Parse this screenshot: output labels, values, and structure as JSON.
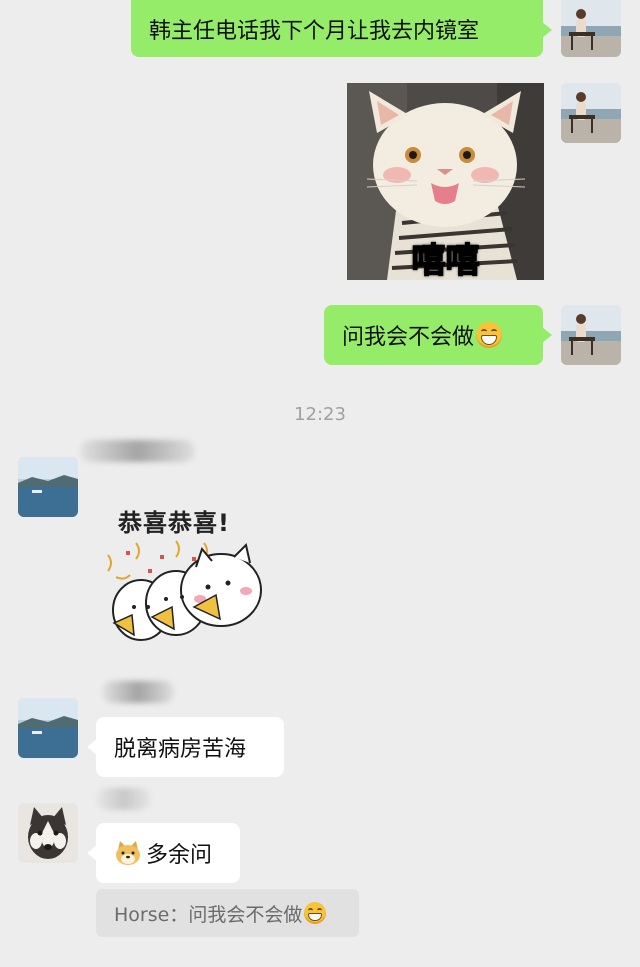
{
  "messages": {
    "m1": {
      "text": "韩主任电话我下个月让我去内镜室"
    },
    "m2": {
      "sticker_caption": "嘻嘻"
    },
    "m3": {
      "text": "问我会不会做"
    },
    "m4": {
      "sticker_caption": "恭喜恭喜!"
    },
    "m5": {
      "text": "脱离病房苦海"
    },
    "m6": {
      "text": "多余问"
    }
  },
  "timestamp": "12:23",
  "quote": {
    "sender": "Horse：",
    "text": "问我会不会做"
  },
  "colors": {
    "background": "#ededed",
    "sent_bubble": "#95ec69",
    "received_bubble": "#ffffff",
    "quote_bg": "#e1e1e1"
  },
  "icons": [
    "grinning-face-emoji",
    "shiba-doge-emoji",
    "lake-avatar",
    "woman-bench-avatar",
    "husky-avatar"
  ]
}
